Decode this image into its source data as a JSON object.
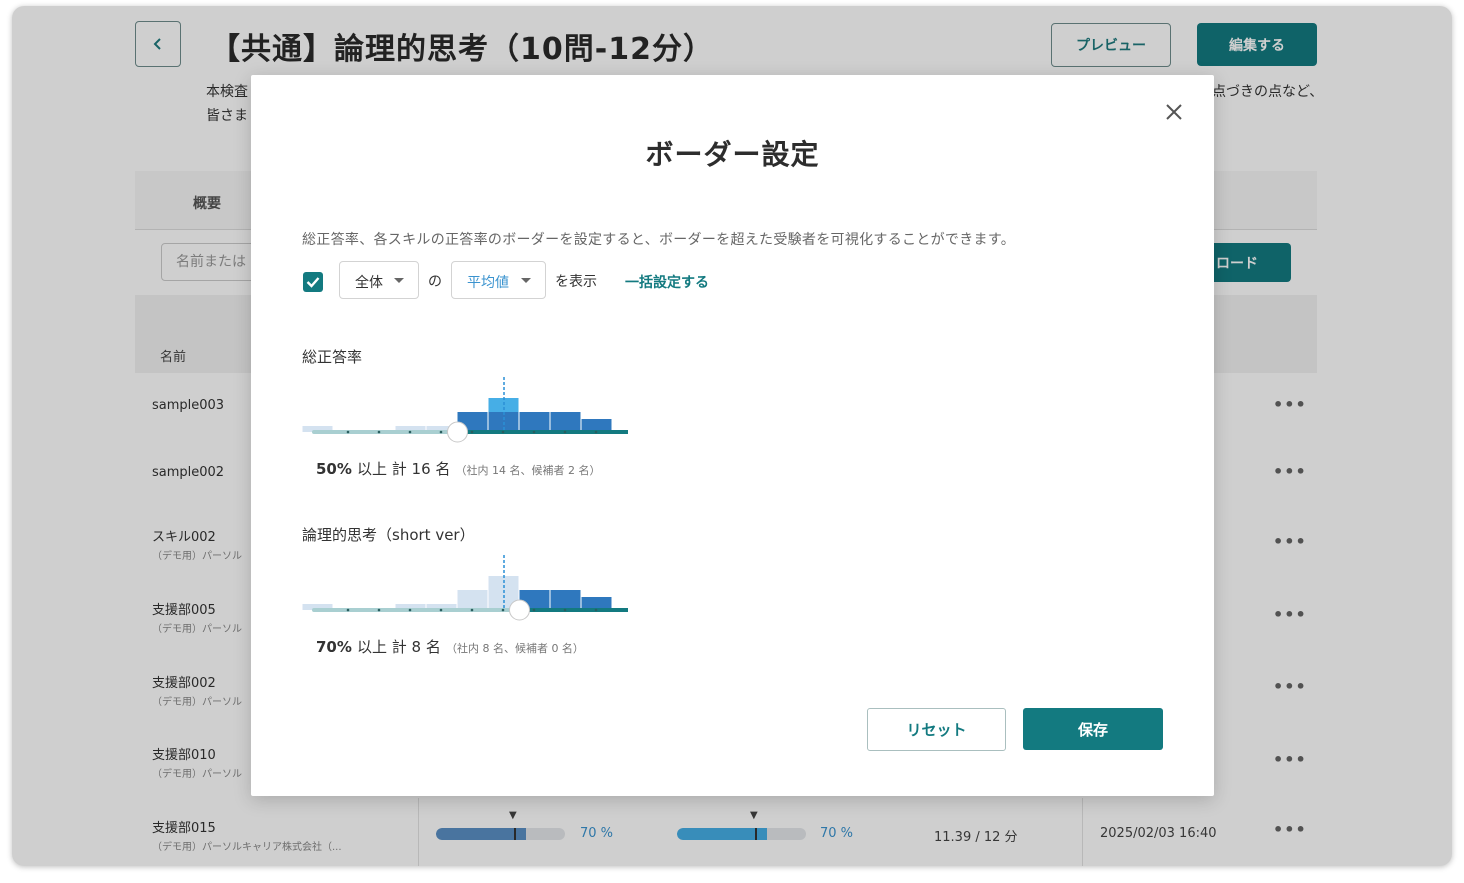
{
  "header": {
    "title": "【共通】論理的思考（10問-12分）",
    "preview_label": "プレビュー",
    "edit_label": "編集する",
    "description_line1_start": "本検査",
    "description_line1_end": "点づきの点など、",
    "description_line2_start": "皆さま"
  },
  "tabs": {
    "overview_label": "概要"
  },
  "toolbar": {
    "search_placeholder": "名前または",
    "download_label": "ロード"
  },
  "table": {
    "name_header": "名前",
    "rows": [
      {
        "name": "sample003",
        "sub": ""
      },
      {
        "name": "sample002",
        "sub": ""
      },
      {
        "name": "スキル002",
        "sub": "（デモ用）パーソル"
      },
      {
        "name": "支援部005",
        "sub": "（デモ用）パーソル"
      },
      {
        "name": "支援部002",
        "sub": "（デモ用）パーソル"
      },
      {
        "name": "支援部010",
        "sub": "（デモ用）パーソル"
      },
      {
        "name": "支援部015",
        "sub": "（デモ用）パーソルキャリア株式会社（...",
        "bar1_pct_label": "70 %",
        "bar2_pct_label": "70 %",
        "bar1_value": 0.7,
        "bar2_value": 0.7,
        "score": "11.39 / 12 分",
        "date": "2025/02/03 16:40"
      }
    ],
    "more_icon_text": "•••",
    "marker_glyph": "▼"
  },
  "modal": {
    "title": "ボーダー設定",
    "description": "総正答率、各スキルの正答率のボーダーを設定すると、ボーダーを超えた受験者を可視化することができます。",
    "display_checkbox_checked": true,
    "scope_select_value": "全体",
    "connector_text": "の",
    "stat_select_value": "平均値",
    "show_text": "を表示",
    "bulk_link": "一括設定する",
    "sections": [
      {
        "label": "総正答率",
        "threshold_label": "50%",
        "summary_main": "以上  計 16 名",
        "summary_sub": "（社内 14 名、候補者 2 名）",
        "border_value": 50,
        "average_value": 65
      },
      {
        "label": "論理的思考（short ver）",
        "threshold_label": "70%",
        "summary_main": "以上  計 8 名",
        "summary_sub": "（社内 8 名、候補者 0 名）",
        "border_value": 70,
        "average_value": 65
      }
    ],
    "reset_label": "リセット",
    "save_label": "保存"
  },
  "colors": {
    "accent": "#137a80",
    "bar_dark": "#2f78be",
    "bar_highlight": "#46aee6",
    "bar_light": "#d4e2f0",
    "track": "#a9cfd1",
    "link_blue": "#3a93cf"
  }
}
